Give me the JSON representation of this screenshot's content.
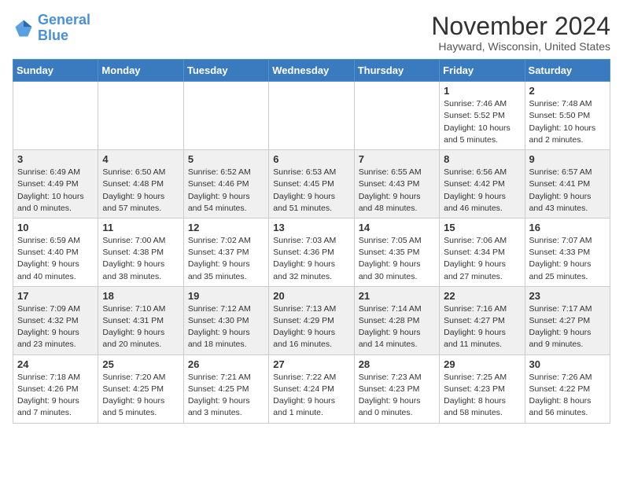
{
  "logo": {
    "line1": "General",
    "line2": "Blue"
  },
  "title": "November 2024",
  "subtitle": "Hayward, Wisconsin, United States",
  "weekdays": [
    "Sunday",
    "Monday",
    "Tuesday",
    "Wednesday",
    "Thursday",
    "Friday",
    "Saturday"
  ],
  "weeks": [
    [
      {
        "day": "",
        "info": ""
      },
      {
        "day": "",
        "info": ""
      },
      {
        "day": "",
        "info": ""
      },
      {
        "day": "",
        "info": ""
      },
      {
        "day": "",
        "info": ""
      },
      {
        "day": "1",
        "info": "Sunrise: 7:46 AM\nSunset: 5:52 PM\nDaylight: 10 hours and 5 minutes."
      },
      {
        "day": "2",
        "info": "Sunrise: 7:48 AM\nSunset: 5:50 PM\nDaylight: 10 hours and 2 minutes."
      }
    ],
    [
      {
        "day": "3",
        "info": "Sunrise: 6:49 AM\nSunset: 4:49 PM\nDaylight: 10 hours and 0 minutes."
      },
      {
        "day": "4",
        "info": "Sunrise: 6:50 AM\nSunset: 4:48 PM\nDaylight: 9 hours and 57 minutes."
      },
      {
        "day": "5",
        "info": "Sunrise: 6:52 AM\nSunset: 4:46 PM\nDaylight: 9 hours and 54 minutes."
      },
      {
        "day": "6",
        "info": "Sunrise: 6:53 AM\nSunset: 4:45 PM\nDaylight: 9 hours and 51 minutes."
      },
      {
        "day": "7",
        "info": "Sunrise: 6:55 AM\nSunset: 4:43 PM\nDaylight: 9 hours and 48 minutes."
      },
      {
        "day": "8",
        "info": "Sunrise: 6:56 AM\nSunset: 4:42 PM\nDaylight: 9 hours and 46 minutes."
      },
      {
        "day": "9",
        "info": "Sunrise: 6:57 AM\nSunset: 4:41 PM\nDaylight: 9 hours and 43 minutes."
      }
    ],
    [
      {
        "day": "10",
        "info": "Sunrise: 6:59 AM\nSunset: 4:40 PM\nDaylight: 9 hours and 40 minutes."
      },
      {
        "day": "11",
        "info": "Sunrise: 7:00 AM\nSunset: 4:38 PM\nDaylight: 9 hours and 38 minutes."
      },
      {
        "day": "12",
        "info": "Sunrise: 7:02 AM\nSunset: 4:37 PM\nDaylight: 9 hours and 35 minutes."
      },
      {
        "day": "13",
        "info": "Sunrise: 7:03 AM\nSunset: 4:36 PM\nDaylight: 9 hours and 32 minutes."
      },
      {
        "day": "14",
        "info": "Sunrise: 7:05 AM\nSunset: 4:35 PM\nDaylight: 9 hours and 30 minutes."
      },
      {
        "day": "15",
        "info": "Sunrise: 7:06 AM\nSunset: 4:34 PM\nDaylight: 9 hours and 27 minutes."
      },
      {
        "day": "16",
        "info": "Sunrise: 7:07 AM\nSunset: 4:33 PM\nDaylight: 9 hours and 25 minutes."
      }
    ],
    [
      {
        "day": "17",
        "info": "Sunrise: 7:09 AM\nSunset: 4:32 PM\nDaylight: 9 hours and 23 minutes."
      },
      {
        "day": "18",
        "info": "Sunrise: 7:10 AM\nSunset: 4:31 PM\nDaylight: 9 hours and 20 minutes."
      },
      {
        "day": "19",
        "info": "Sunrise: 7:12 AM\nSunset: 4:30 PM\nDaylight: 9 hours and 18 minutes."
      },
      {
        "day": "20",
        "info": "Sunrise: 7:13 AM\nSunset: 4:29 PM\nDaylight: 9 hours and 16 minutes."
      },
      {
        "day": "21",
        "info": "Sunrise: 7:14 AM\nSunset: 4:28 PM\nDaylight: 9 hours and 14 minutes."
      },
      {
        "day": "22",
        "info": "Sunrise: 7:16 AM\nSunset: 4:27 PM\nDaylight: 9 hours and 11 minutes."
      },
      {
        "day": "23",
        "info": "Sunrise: 7:17 AM\nSunset: 4:27 PM\nDaylight: 9 hours and 9 minutes."
      }
    ],
    [
      {
        "day": "24",
        "info": "Sunrise: 7:18 AM\nSunset: 4:26 PM\nDaylight: 9 hours and 7 minutes."
      },
      {
        "day": "25",
        "info": "Sunrise: 7:20 AM\nSunset: 4:25 PM\nDaylight: 9 hours and 5 minutes."
      },
      {
        "day": "26",
        "info": "Sunrise: 7:21 AM\nSunset: 4:25 PM\nDaylight: 9 hours and 3 minutes."
      },
      {
        "day": "27",
        "info": "Sunrise: 7:22 AM\nSunset: 4:24 PM\nDaylight: 9 hours and 1 minute."
      },
      {
        "day": "28",
        "info": "Sunrise: 7:23 AM\nSunset: 4:23 PM\nDaylight: 9 hours and 0 minutes."
      },
      {
        "day": "29",
        "info": "Sunrise: 7:25 AM\nSunset: 4:23 PM\nDaylight: 8 hours and 58 minutes."
      },
      {
        "day": "30",
        "info": "Sunrise: 7:26 AM\nSunset: 4:22 PM\nDaylight: 8 hours and 56 minutes."
      }
    ]
  ]
}
